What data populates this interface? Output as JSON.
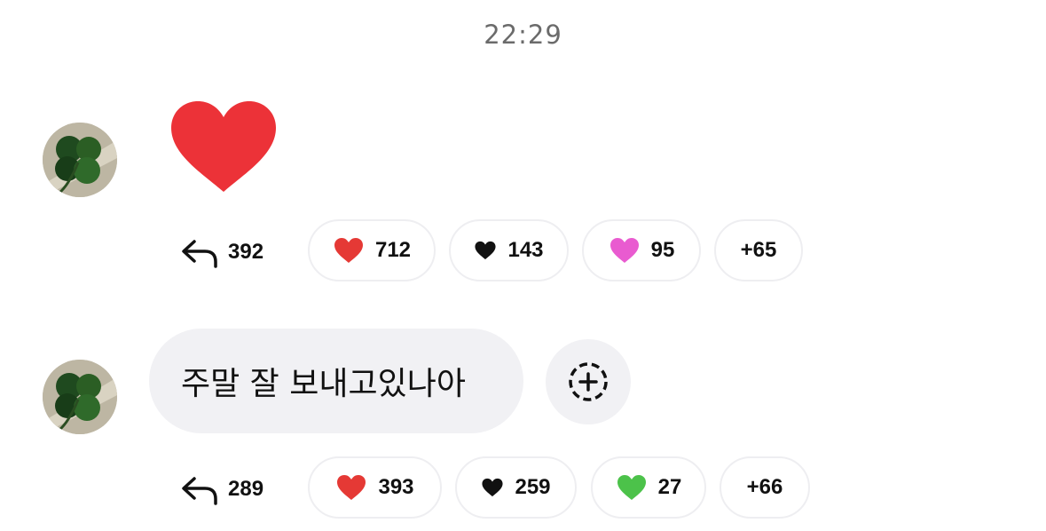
{
  "timestamp": "22:29",
  "messages": [
    {
      "type": "heart-emoji",
      "reply_count": "392",
      "reactions": [
        {
          "icon": "red-heart-icon",
          "count": "712",
          "color": "#e53935"
        },
        {
          "icon": "black-heart-icon",
          "count": "143",
          "color": "#111111"
        },
        {
          "icon": "pink-heart-icon",
          "count": "95",
          "color": "#e95bd0"
        }
      ],
      "more": "+65"
    },
    {
      "type": "text",
      "text": "주말 잘 보내고있나아",
      "reply_count": "289",
      "reactions": [
        {
          "icon": "red-heart-icon",
          "count": "393",
          "color": "#e53935"
        },
        {
          "icon": "black-heart-icon",
          "count": "259",
          "color": "#111111"
        },
        {
          "icon": "green-heart-icon",
          "count": "27",
          "color": "#4cc24a"
        }
      ],
      "more": "+66"
    }
  ],
  "colors": {
    "big_heart": "#ec3238",
    "bubble_bg": "#f1f1f4"
  }
}
